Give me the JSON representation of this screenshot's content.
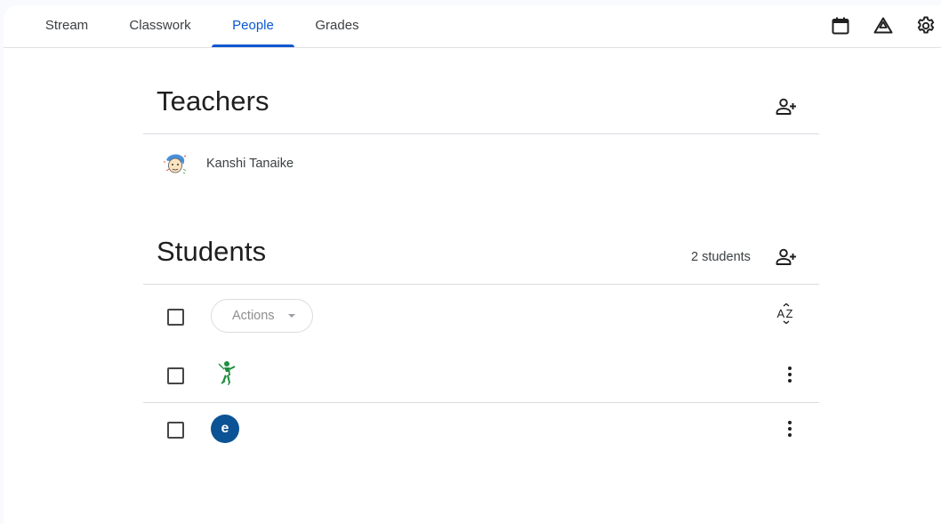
{
  "tabs": [
    {
      "label": "Stream",
      "active": false
    },
    {
      "label": "Classwork",
      "active": false
    },
    {
      "label": "People",
      "active": true
    },
    {
      "label": "Grades",
      "active": false
    }
  ],
  "toolbar_icons": [
    "calendar-icon",
    "drive-icon",
    "settings-icon"
  ],
  "accent_color": "#0b57d0",
  "teachers": {
    "title": "Teachers",
    "items": [
      {
        "name": "Kanshi Tanaike"
      }
    ]
  },
  "students": {
    "title": "Students",
    "count_label": "2 students",
    "actions_label": "Actions",
    "rows": [
      {
        "avatar": "fencer-image",
        "name": ""
      },
      {
        "avatar_letter": "e",
        "avatar_color": "#0b5394",
        "name": ""
      }
    ]
  }
}
